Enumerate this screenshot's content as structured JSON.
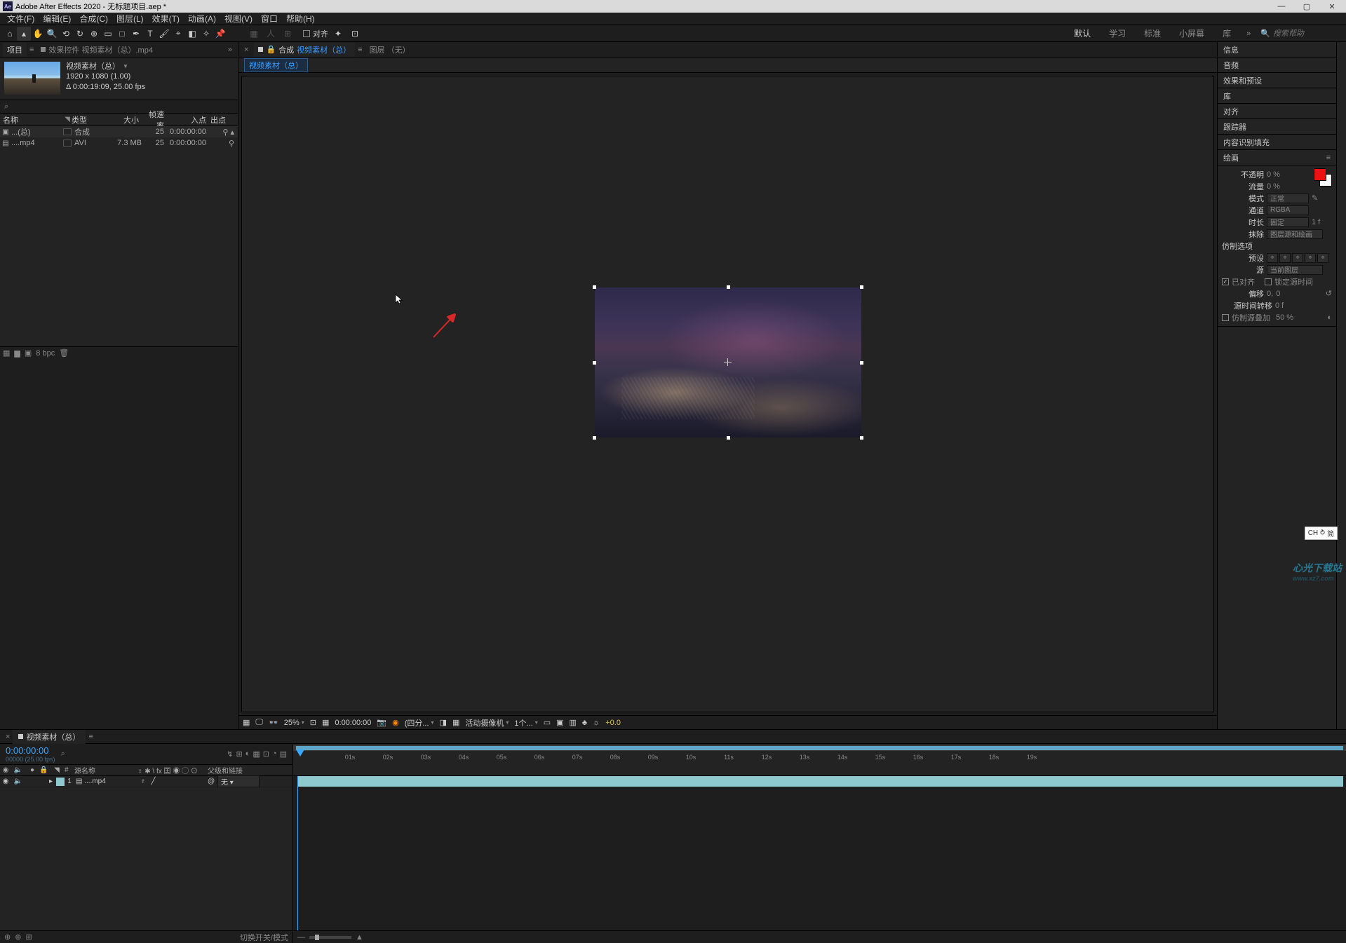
{
  "titlebar": {
    "app": "Adobe After Effects 2020",
    "project": "无标题项目.aep *"
  },
  "menu": {
    "file": "文件(F)",
    "edit": "编辑(E)",
    "composition": "合成(C)",
    "layer": "图层(L)",
    "effect": "效果(T)",
    "animation": "动画(A)",
    "view": "视图(V)",
    "window": "窗口",
    "help": "帮助(H)"
  },
  "toolbar": {
    "snap_label": "对齐",
    "workspaces": {
      "default": "默认",
      "learn": "学习",
      "standard": "标准",
      "small": "小屏幕",
      "libraries": "库"
    },
    "search_placeholder": "搜索帮助"
  },
  "project_panel": {
    "tab_project": "项目",
    "tab_effectcontrols": "效果控件 视频素材（总）.mp4",
    "selected": {
      "name": "视频素材（总）",
      "dims": "1920 x 1080 (1.00)",
      "dur": "Δ 0:00:19:09, 25.00 fps"
    },
    "headers": {
      "name": "名称",
      "type": "类型",
      "size": "大小",
      "fps": "帧速率",
      "in": "入点",
      "out": "出点"
    },
    "rows": [
      {
        "icon": "comp",
        "name": "...(总)",
        "type": "合成",
        "size": "",
        "fps": "25",
        "in": "0:00:00:00",
        "out_extra": "⚲ ▴"
      },
      {
        "icon": "avi",
        "name": "....mp4",
        "type": "AVI",
        "size": "7.3 MB",
        "fps": "25",
        "in": "0:00:00:00",
        "out_extra": "⚲"
      }
    ],
    "footer_bpc": "8 bpc"
  },
  "comp_panel": {
    "tab_comp_prefix": "合成",
    "tab_comp_name": "视频素材（总）",
    "tab_layer": "图层 （无）",
    "flowchart_item": "视频素材（总）"
  },
  "viewer_footer": {
    "zoom": "25%",
    "timecode": "0:00:00:00",
    "res": "(四分...",
    "camera": "活动摄像机",
    "views": "1个...",
    "exposure": "+0.0"
  },
  "right_panels": {
    "info": "信息",
    "audio": "音频",
    "effects": "效果和预设",
    "libraries": "库",
    "align": "对齐",
    "tracker": "跟踪器",
    "caf": "内容识别填充",
    "paint": "绘画"
  },
  "paint": {
    "opacity_lbl": "不透明",
    "opacity_val": "0 %",
    "flow_lbl": "流量",
    "flow_val": "0 %",
    "mode_lbl": "模式",
    "mode_val": "正常",
    "channels_lbl": "通道",
    "channels_val": "RGBA",
    "duration_lbl": "时长",
    "duration_val": "固定",
    "duration_frames": "1 f",
    "erase_lbl": "抹除",
    "erase_val": "图层源和绘画",
    "clone_lbl": "仿制选项",
    "preset_lbl": "预设",
    "source_lbl": "源",
    "source_val": "当前图层",
    "aligned_lbl": "已对齐",
    "lock_lbl": "锁定源时间",
    "offset_lbl": "偏移",
    "offset_x": "0,",
    "offset_y": "0",
    "timeshift_lbl": "源时间转移",
    "timeshift_val": "0 f",
    "overlay_lbl": "仿制源叠加",
    "overlay_val": "50 %"
  },
  "timeline": {
    "tab": "视频素材（总）",
    "timecode": "0:00:00:00",
    "sub_timecode": "00000 (25.00 fps)",
    "header_source": "源名称",
    "header_switches": "♀ ✱ \\ fx 囯 ◉ ◯ ⊙",
    "header_parent": "父级和链接",
    "ruler": [
      "",
      "01s",
      "02s",
      "03s",
      "04s",
      "05s",
      "06s",
      "07s",
      "08s",
      "09s",
      "10s",
      "11s",
      "12s",
      "13s",
      "14s",
      "15s",
      "16s",
      "17s",
      "18s",
      "19s"
    ],
    "layer": {
      "num": "1",
      "name": "....mp4",
      "parent": "无"
    },
    "footer_switch": "切换开关/模式"
  },
  "ime": {
    "ch": "CH",
    "mode": "简"
  },
  "watermark": {
    "main": "心光下载站",
    "sub": "www.xz7.com"
  }
}
